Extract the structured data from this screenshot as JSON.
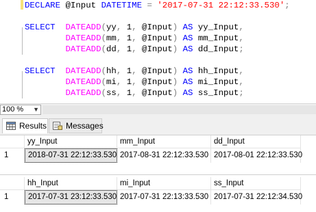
{
  "editor": {
    "lines": [
      "DECLARE @Input DATETIME = '2017-07-31 22:12:33.530';",
      "SELECT  DATEADD(yy, 1, @Input) AS yy_Input,",
      "        DATEADD(mm, 1, @Input) AS mm_Input,",
      "        DATEADD(dd, 1, @Input) AS dd_Input;",
      "SELECT  DATEADD(hh, 1, @Input) AS hh_Input,",
      "        DATEADD(mi, 1, @Input) AS mi_Input,",
      "        DATEADD(ss, 1, @Input) AS ss_Input;"
    ]
  },
  "zoom": {
    "value": "100 %"
  },
  "tabs": {
    "results": "Results",
    "messages": "Messages"
  },
  "grids": [
    {
      "columns": [
        "yy_Input",
        "mm_Input",
        "dd_Input"
      ],
      "rows": [
        {
          "num": "1",
          "cells": [
            "2018-07-31 22:12:33.530",
            "2017-08-31 22:12:33.530",
            "2017-08-01 22:12:33.530"
          ]
        }
      ]
    },
    {
      "columns": [
        "hh_Input",
        "mi_Input",
        "ss_Input"
      ],
      "rows": [
        {
          "num": "1",
          "cells": [
            "2017-07-31 23:12:33.530",
            "2017-07-31 22:13:33.530",
            "2017-07-31 22:12:34.530"
          ]
        }
      ]
    }
  ],
  "colors": {
    "keyword": "#0000ff",
    "function": "#ff00ff",
    "string": "#ff0000",
    "operator": "#808080"
  }
}
